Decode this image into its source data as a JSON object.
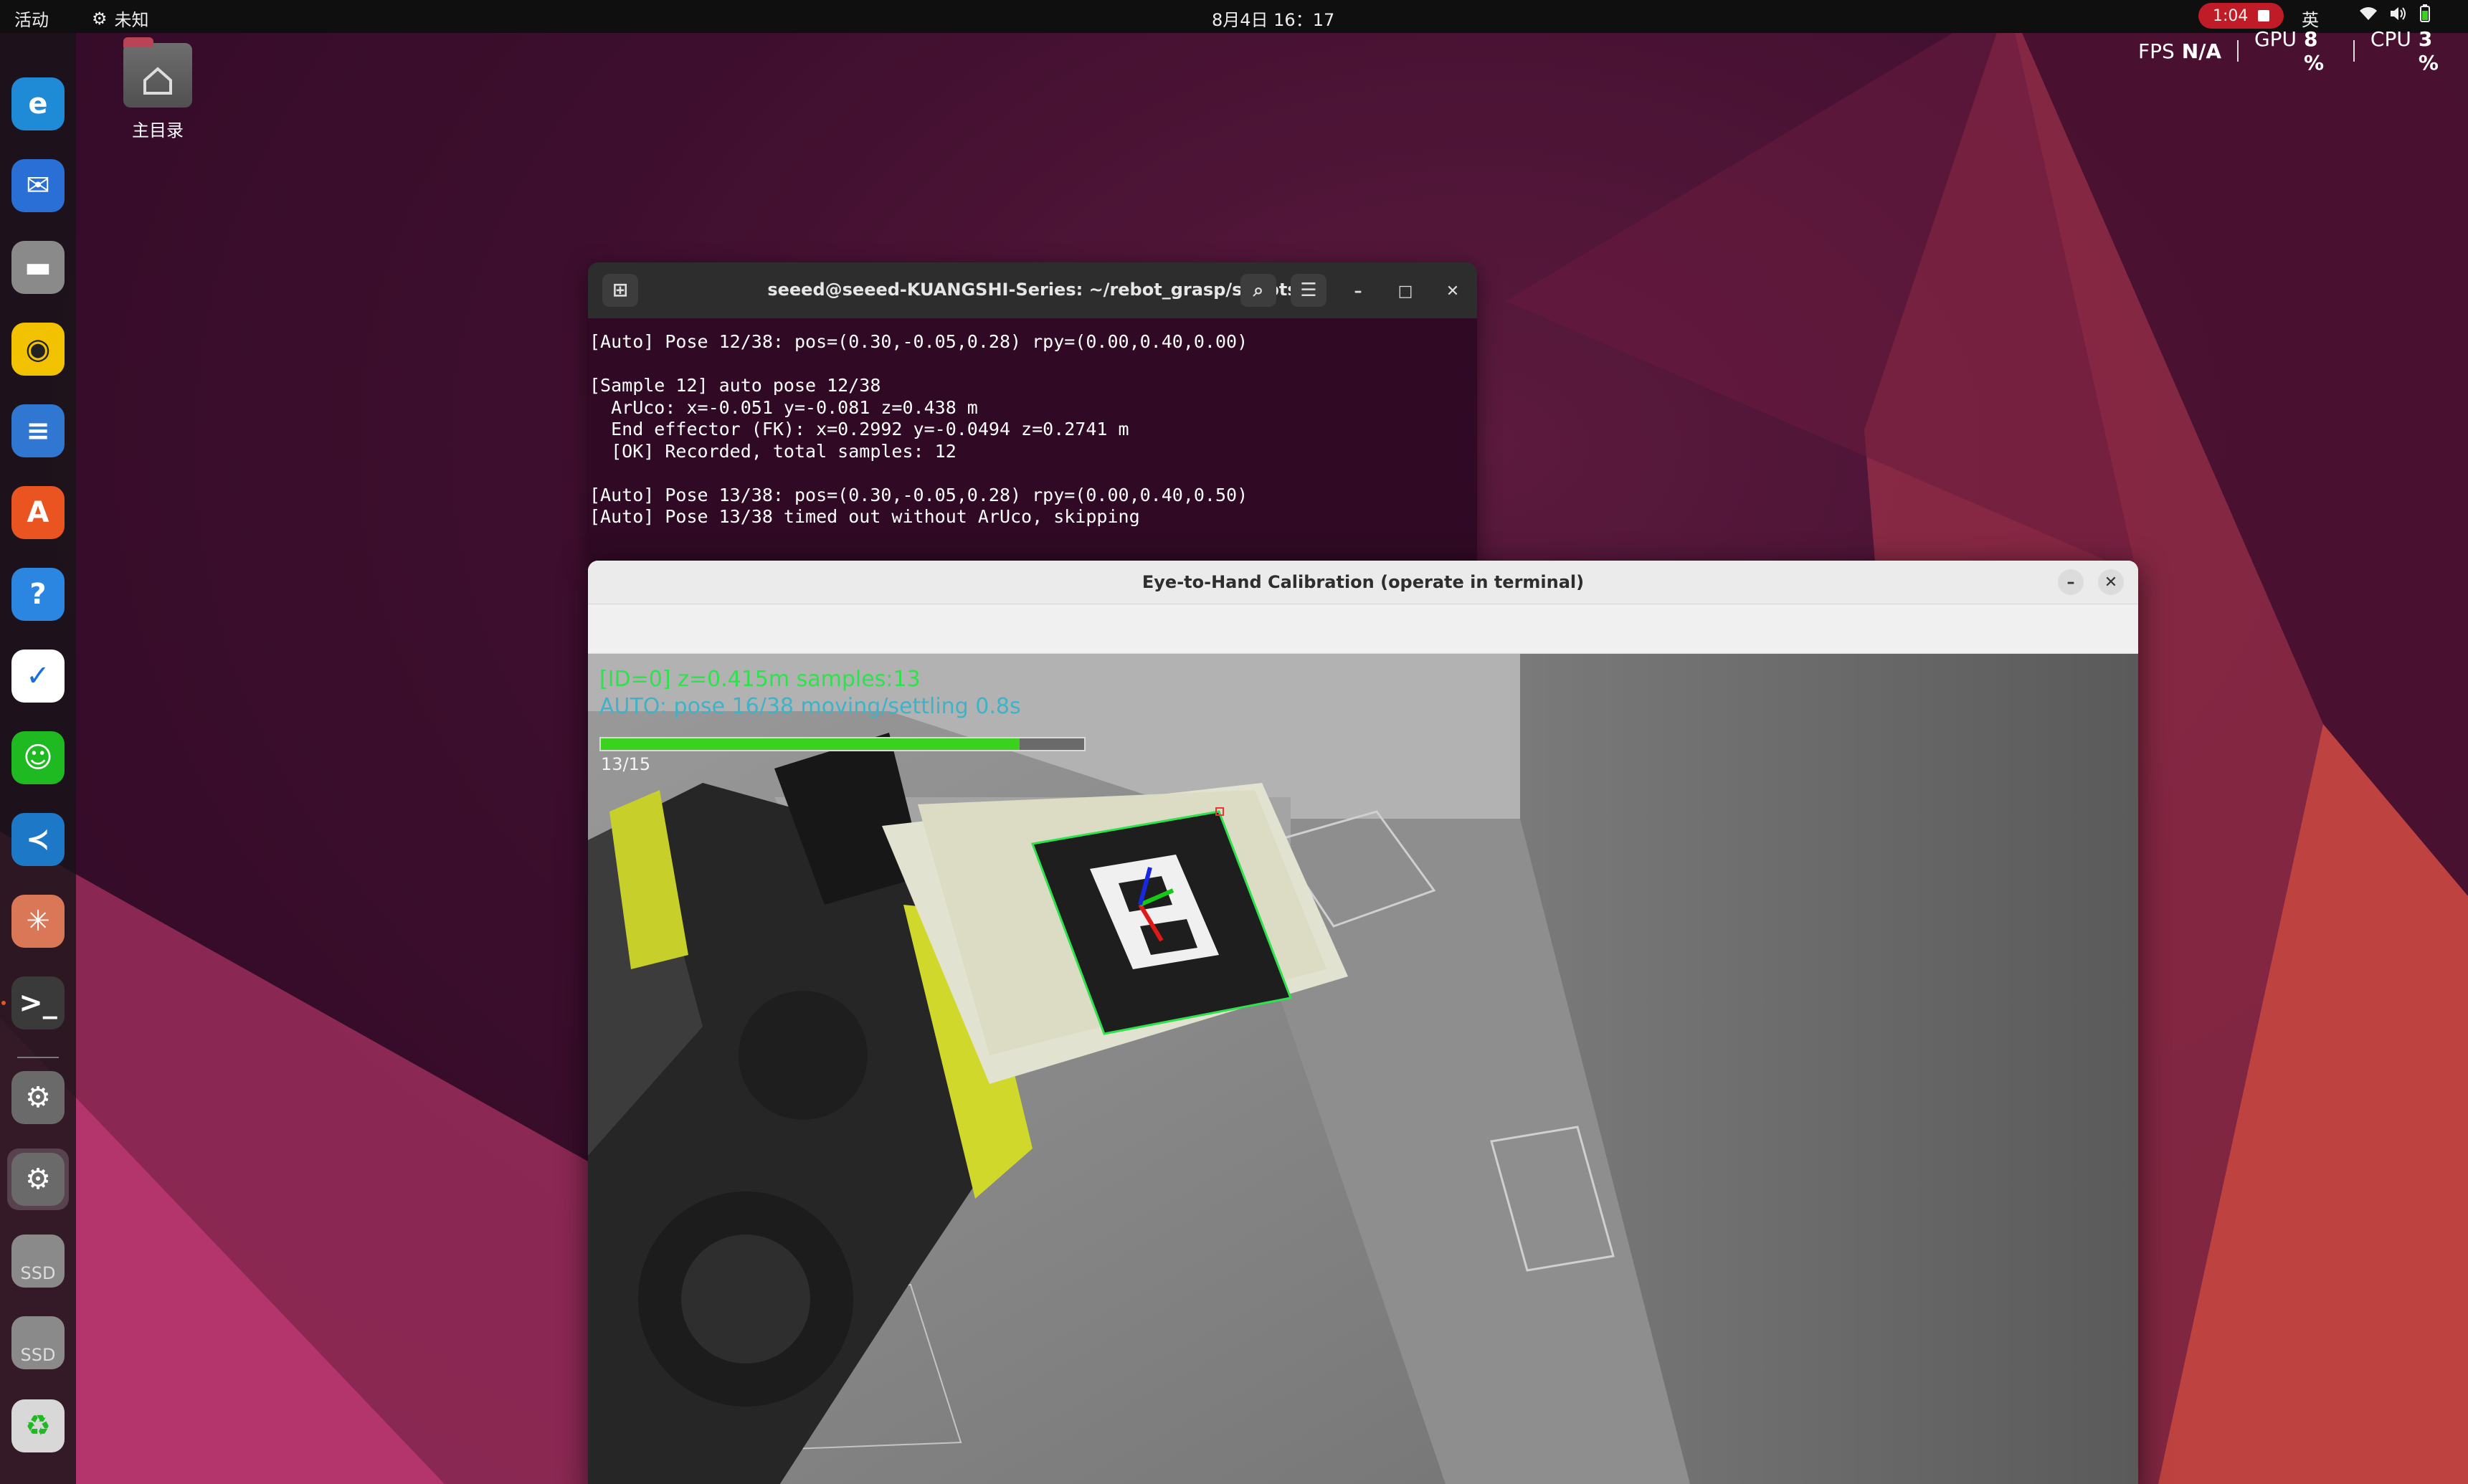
{
  "topbar": {
    "activities": "活动",
    "app_menu": "未知",
    "clock": "8月4日 16：17",
    "recording_time": "1:04",
    "input_method": "英"
  },
  "monitor": {
    "fps_label": "FPS",
    "fps_value": "N/A",
    "gpu_label": "GPU",
    "gpu_value": "8 %",
    "cpu_label": "CPU",
    "cpu_value": "3 %"
  },
  "desktop": {
    "home_label": "主目录"
  },
  "dock": {
    "items": [
      {
        "icon": "edge-browser-icon",
        "color": "#1f8bd6"
      },
      {
        "icon": "thunderbird-icon",
        "color": "#2a6fd6"
      },
      {
        "icon": "files-icon",
        "color": "#8a8a8a"
      },
      {
        "icon": "rhythmbox-icon",
        "color": "#f2c200"
      },
      {
        "icon": "writer-icon",
        "color": "#2f77d0"
      },
      {
        "icon": "app-center-icon",
        "color": "#e95420"
      },
      {
        "icon": "help-icon",
        "color": "#2a86e0"
      },
      {
        "icon": "feishu-icon",
        "color": "#ffffff"
      },
      {
        "icon": "wechat-icon",
        "color": "#1fb922"
      },
      {
        "icon": "vscode-icon",
        "color": "#1e78c8"
      },
      {
        "icon": "claude-icon",
        "color": "#d97757"
      },
      {
        "icon": "terminal-icon",
        "color": "#3a3a3a"
      },
      {
        "icon": "settings-icon",
        "color": "#6a6a6a"
      },
      {
        "icon": "settings-active-icon",
        "color": "#6a6a6a"
      },
      {
        "icon": "ssd-drive-icon",
        "color": "#8a8a8a",
        "label": "SSD"
      },
      {
        "icon": "ssd-drive-icon",
        "color": "#8a8a8a",
        "label": "SSD"
      },
      {
        "icon": "trash-icon",
        "color": "#d8d8d8"
      }
    ]
  },
  "terminal": {
    "title": "seeed@seeed-KUANGSHI-Series: ~/rebot_grasp/scripts",
    "lines": [
      "[Auto] Pose 12/38: pos=(0.30,-0.05,0.28) rpy=(0.00,0.40,0.00)",
      "",
      "[Sample 12] auto pose 12/38",
      "  ArUco: x=-0.051 y=-0.081 z=0.438 m",
      "  End effector (FK): x=0.2992 y=-0.0494 z=0.2741 m",
      "  [OK] Recorded, total samples: 12",
      "",
      "[Auto] Pose 13/38: pos=(0.30,-0.05,0.28) rpy=(0.00,0.40,0.50)",
      "[Auto] Pose 13/38 timed out without ArUco, skipping"
    ]
  },
  "calibration": {
    "title": "Eye-to-Hand Calibration  (operate in terminal)",
    "overlay_status": "[ID=0] z=0.415m  samples:13",
    "overlay_auto": "AUTO: pose 16/38 moving/settling 0.8s",
    "progress_label": "13/15",
    "progress_fraction": 0.8667,
    "colors": {
      "status": "#2ee24d",
      "auto": "#3fb2c8",
      "progress": "#3ad21e"
    }
  }
}
